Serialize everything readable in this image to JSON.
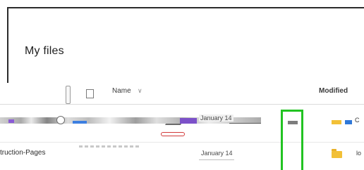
{
  "header": {
    "title": "My files"
  },
  "columns": {
    "name_label": "Name",
    "name_sort_icon": "chevron-down-icon",
    "modified_label": "Modified"
  },
  "rows": [
    {
      "modified": "January 14",
      "tail_text": "C"
    },
    {
      "name": "truction-Pages",
      "modified": "January 14",
      "tail_text": "lo"
    }
  ],
  "colors": {
    "highlight": "#22c322",
    "folder": "#f2c037",
    "accent_blue": "#2f78d8",
    "accent_purple": "#7c51c9",
    "accent_red": "#d23a3a"
  }
}
